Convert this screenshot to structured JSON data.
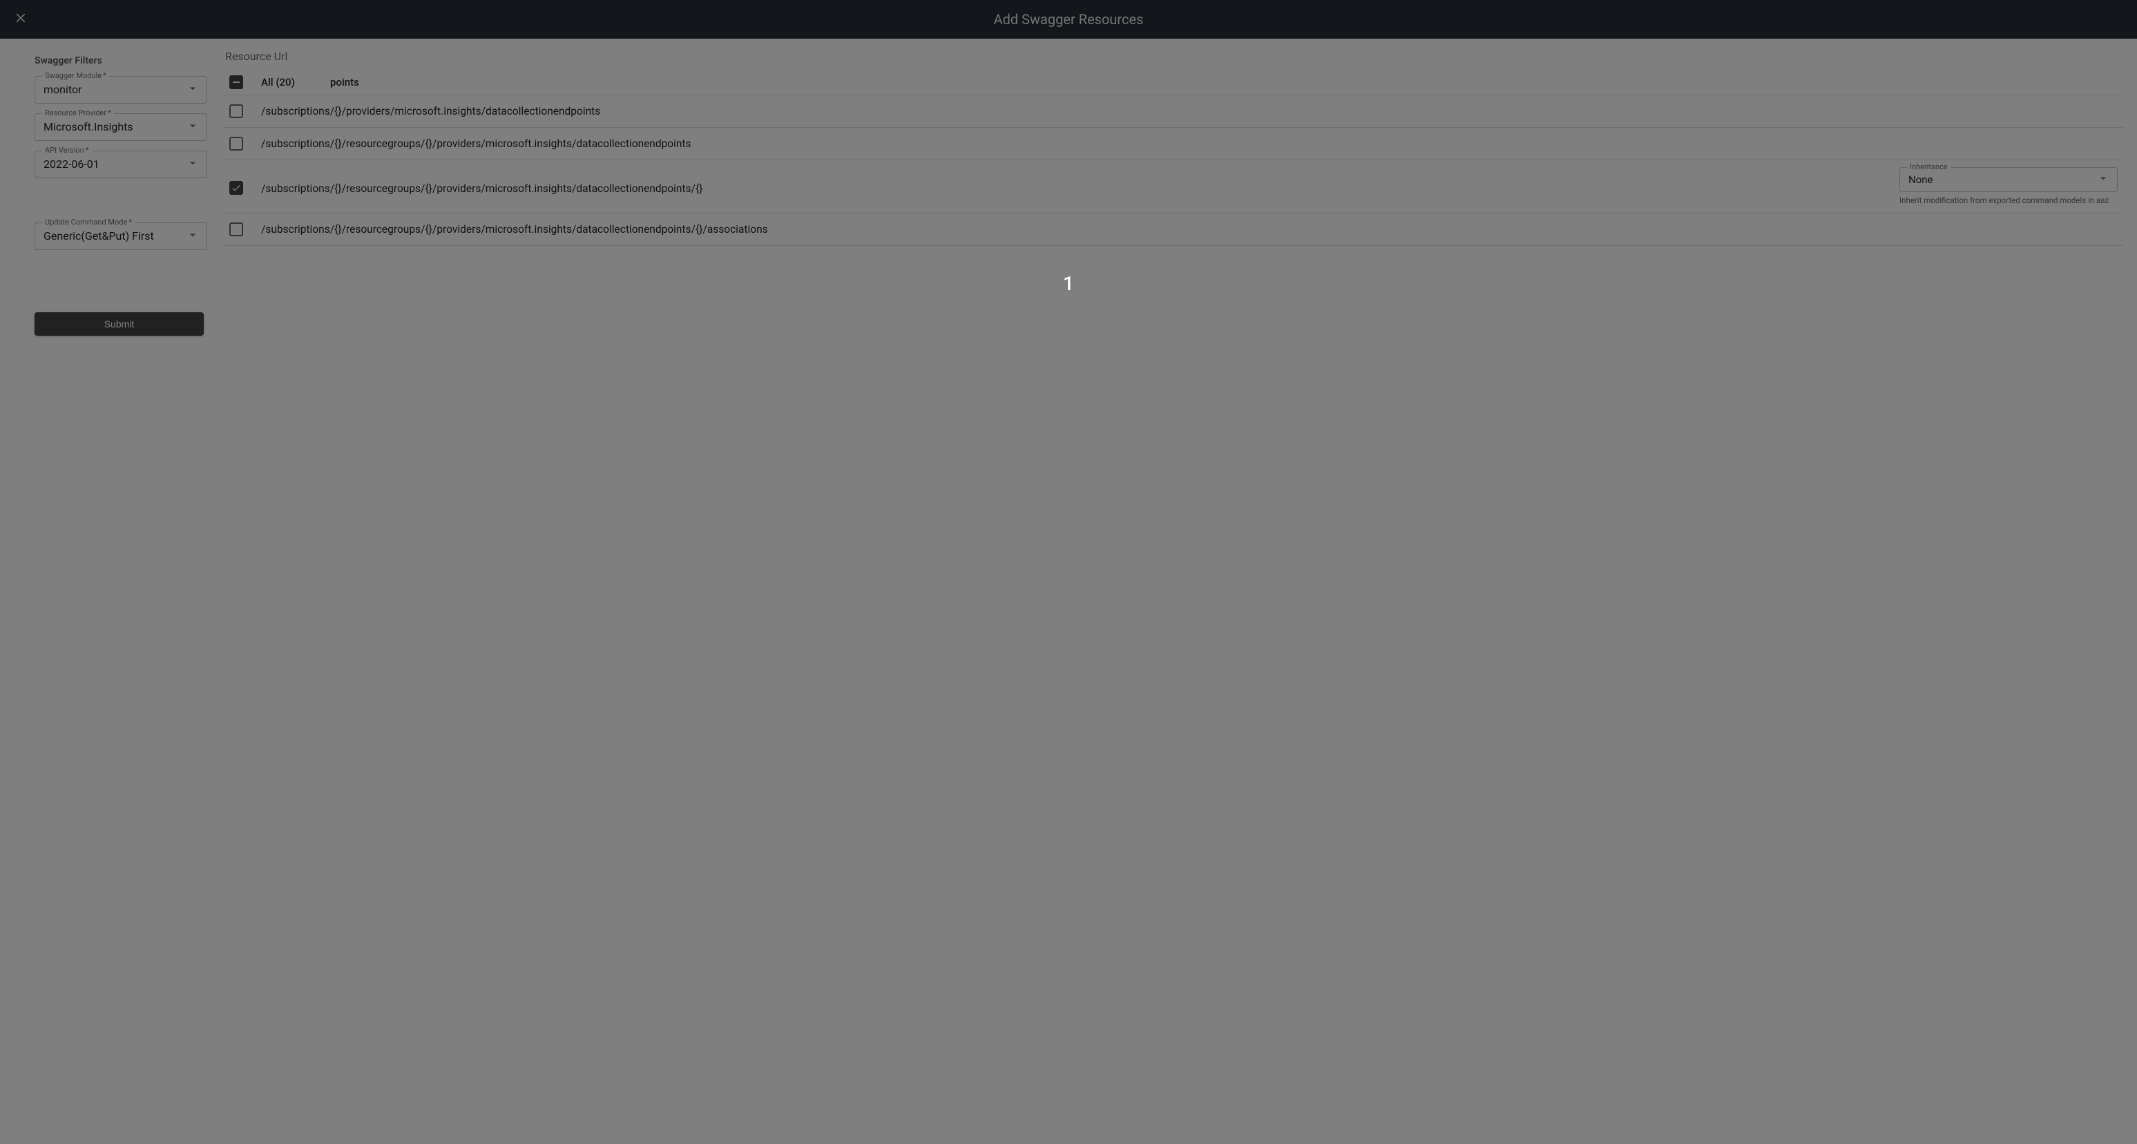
{
  "header": {
    "title": "Add Swagger Resources"
  },
  "sidebar": {
    "title": "Swagger Filters",
    "swagger_module": {
      "label": "Swagger Module",
      "value": "monitor",
      "required": "*"
    },
    "resource_provider": {
      "label": "Resource Provider",
      "value": "Microsoft.Insights",
      "required": "*"
    },
    "api_version": {
      "label": "API Version",
      "value": "2022-06-01",
      "required": "*"
    },
    "update_mode": {
      "label": "Update Command Mode",
      "value": "Generic(Get&Put) First",
      "required": "*"
    },
    "submit": "Submit"
  },
  "main": {
    "title": "Resource Url",
    "header_all": "All (20)",
    "header_points": "points",
    "rows": {
      "r0": {
        "text": "/subscriptions/{}/providers/microsoft.insights/datacollectionendpoints"
      },
      "r1": {
        "text": "/subscriptions/{}/resourcegroups/{}/providers/microsoft.insights/datacollectionendpoints"
      },
      "r2": {
        "text": "/subscriptions/{}/resourcegroups/{}/providers/microsoft.insights/datacollectionendpoints/{}"
      },
      "r3": {
        "text": "/subscriptions/{}/resourcegroups/{}/providers/microsoft.insights/datacollectionendpoints/{}/associations"
      }
    },
    "inheritance": {
      "label": "Inheritance",
      "value": "None",
      "help": "Inherit modification from exported command models in aaz"
    }
  },
  "toast": "1"
}
